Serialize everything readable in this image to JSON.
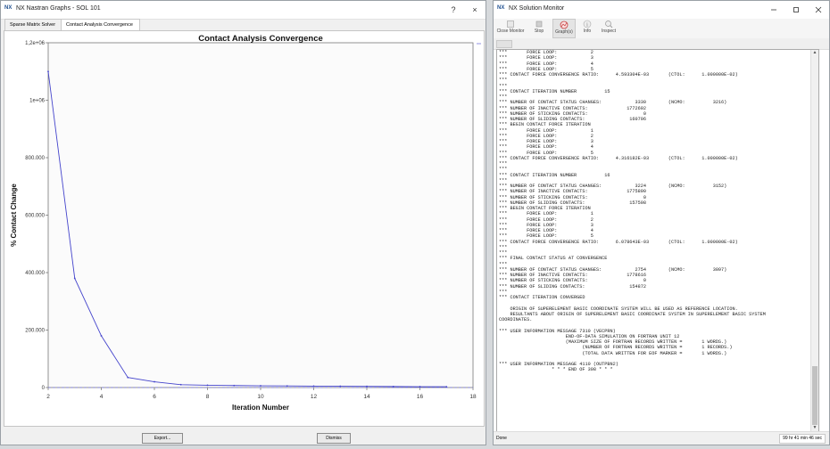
{
  "nastran_window": {
    "logo": "NX",
    "title": "NX Nastran Graphs - SOL 101",
    "help": "?",
    "close": "×",
    "tabs": [
      "Sparse Matrix Solver",
      "Contact Analysis Convergence"
    ],
    "export_label": "Export...",
    "dismiss_label": "Dismiss"
  },
  "chart_data": {
    "type": "line",
    "title": "Contact Analysis Convergence",
    "xlabel": "Iteration Number",
    "ylabel": "% Contact Change",
    "xlim": [
      2,
      18
    ],
    "ylim": [
      0,
      1200000
    ],
    "x_ticks": [
      "2",
      "4",
      "6",
      "8",
      "10",
      "12",
      "14",
      "16",
      "18"
    ],
    "y_ticks": [
      "0",
      "200.000",
      "400.000",
      "600.000",
      "800.000",
      "1e+06",
      "1,2e+06"
    ],
    "series": [
      {
        "color": "#4444cc",
        "x": [
          2,
          3,
          4,
          5,
          6,
          7,
          8,
          9,
          10,
          11,
          12,
          13,
          14,
          15,
          16,
          17
        ],
        "y": [
          1100000,
          380000,
          180000,
          35000,
          20000,
          10000,
          8000,
          7000,
          6000,
          5500,
          5000,
          4500,
          4000,
          3500,
          3000,
          2800
        ]
      }
    ],
    "reference_line": {
      "y": 0,
      "style": "dashed",
      "color": "#7777dd"
    },
    "grid": true
  },
  "monitor_window": {
    "logo": "NX",
    "title": "NX Solution Monitor",
    "toolbar": [
      {
        "label": "Close Monitor",
        "icon": "close-monitor-icon"
      },
      {
        "label": "Stop",
        "icon": "stop-icon"
      },
      {
        "label": "Graph(s)",
        "icon": "graph-icon"
      },
      {
        "label": "Info",
        "icon": "info-icon"
      },
      {
        "label": "Inspect",
        "icon": "inspect-icon"
      }
    ],
    "log_text": "***       FORCE LOOP:            2\n***       FORCE LOOP:            3\n***       FORCE LOOP:            4\n***       FORCE LOOP:            5\n*** CONTACT FORCE CONVERGENCE RATIO:      4.593304E-03       (CTOL:      1.000000E-02)\n***\n***\n*** CONTACT ITERATION NUMBER          15\n***\n*** NUMBER OF CONTACT STATUS CHANGES:            3330        (NCMO:          3216)\n*** NUMBER OF INACTIVE CONTACTS:              1772692\n*** NUMBER OF STICKING CONTACTS:                    0\n*** NUMBER OF SLIDING CONTACTS:                160796\n*** BEGIN CONTACT FORCE ITERATION\n***       FORCE LOOP:            1\n***       FORCE LOOP:            2\n***       FORCE LOOP:            3\n***       FORCE LOOP:            4\n***       FORCE LOOP:            5\n*** CONTACT FORCE CONVERGENCE RATIO:      4.316182E-03       (CTOL:      1.000000E-02)\n***\n***\n*** CONTACT ITERATION NUMBER          16\n***\n*** NUMBER OF CONTACT STATUS CHANGES:            3224        (NCMO:          3152)\n*** NUMBER OF INACTIVE CONTACTS:              1775890\n*** NUMBER OF STICKING CONTACTS:                    0\n*** NUMBER OF SLIDING CONTACTS:                157598\n*** BEGIN CONTACT FORCE ITERATION\n***       FORCE LOOP:            1\n***       FORCE LOOP:            2\n***       FORCE LOOP:            3\n***       FORCE LOOP:            4\n***       FORCE LOOP:            5\n*** CONTACT FORCE CONVERGENCE RATIO:      6.078643E-03       (CTOL:      1.000000E-02)\n***\n***\n*** FINAL CONTACT STATUS AT CONVERGENCE\n***\n*** NUMBER OF CONTACT STATUS CHANGES:            2754        (NCMO:          3097)\n*** NUMBER OF INACTIVE CONTACTS:              1778616\n*** NUMBER OF STICKING CONTACTS:                    0\n*** NUMBER OF SLIDING CONTACTS:                154872\n***\n*** CONTACT ITERATION CONVERGED\n\n    ORIGIN OF SUPERELEMENT BASIC COORDINATE SYSTEM WILL BE USED AS REFERENCE LOCATION.\n    RESULTANTS ABOUT ORIGIN OF SUPERELEMENT BASIC COORDINATE SYSTEM IN SUPERELEMENT BASIC SYSTEM\nCOORDINATES.\n\n*** USER INFORMATION MESSAGE 7310 (VECPRN)\n                        END-OF-DATA SIMULATION ON FORTRAN UNIT 12\n                        (MAXIMUM SIZE OF FORTRAN RECORDS WRITTEN =       1 WORDS.)\n                              (NUMBER OF FORTRAN RECORDS WRITTEN =       1 RECORDS.)\n                              (TOTAL DATA WRITTEN FOR EOF MARKER =       1 WORDS.)\n\n*** USER INFORMATION MESSAGE 4110 (OUTPBN2)\n                   * * * END OF 308 * * *",
    "status": "Done",
    "elapsed": "99 hr 41 min 46 sec"
  }
}
